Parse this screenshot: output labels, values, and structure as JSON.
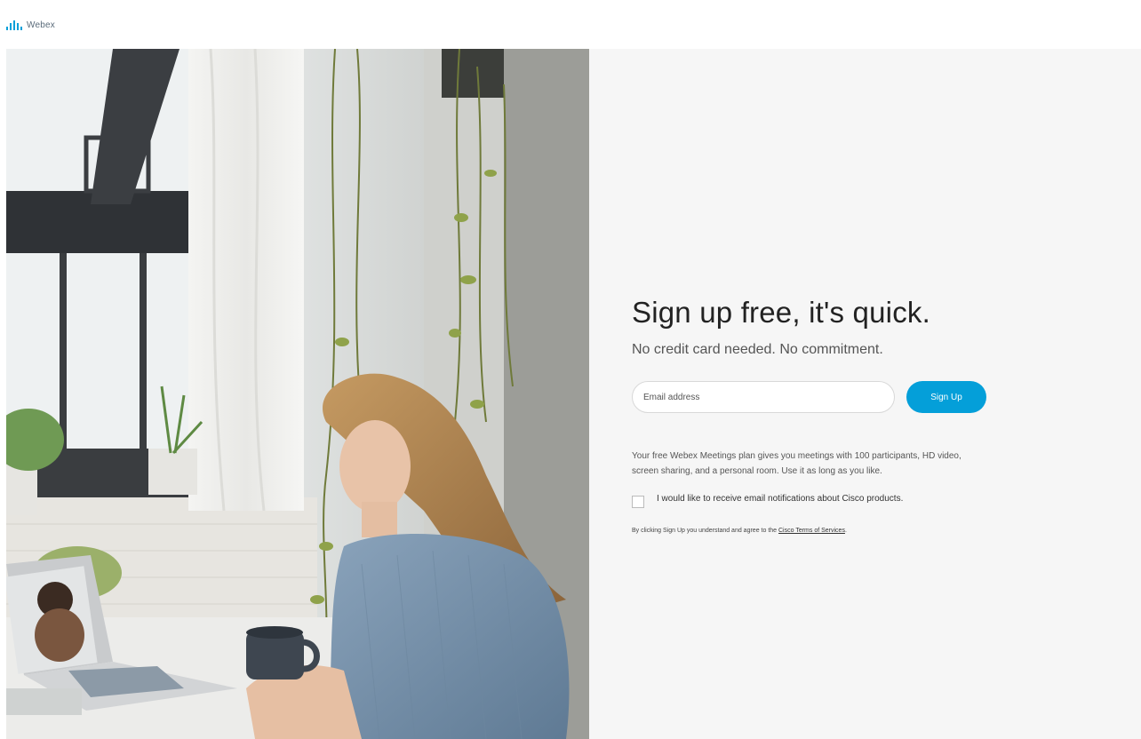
{
  "header": {
    "brand_name": "Webex",
    "brand_color": "#049fd9"
  },
  "hero": {
    "description": "Photo: woman at a cafe window holding a mug, on a video call with a laptop"
  },
  "signup": {
    "headline": "Sign up free, it's quick.",
    "subheadline": "No credit card needed. No commitment.",
    "email_placeholder": "Email address",
    "email_value": "",
    "submit_label": "Sign Up",
    "plan_description": "Your free Webex Meetings plan gives you meetings with 100 participants, HD video, screen sharing, and a personal room. Use it as long as you like.",
    "checkbox_label": "I would like to receive email notifications about Cisco products.",
    "checkbox_checked": false,
    "terms_prefix": "By clicking Sign Up you understand and agree to the ",
    "terms_link": "Cisco Terms of Services",
    "terms_suffix": "."
  }
}
